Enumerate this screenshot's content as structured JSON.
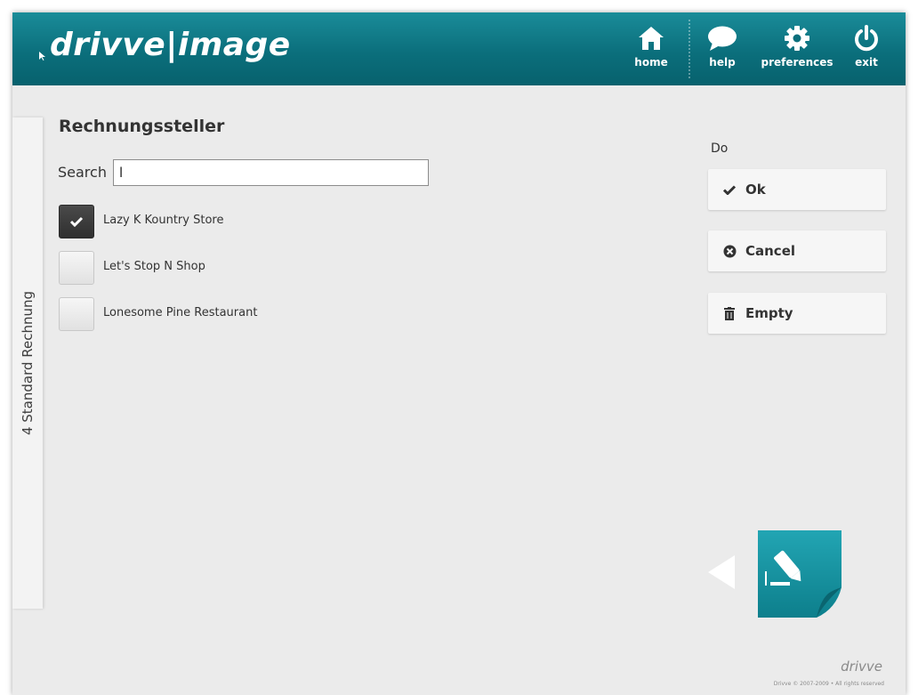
{
  "header": {
    "logo_text": "drivve|image",
    "nav": [
      {
        "label": "home",
        "icon": "home-icon"
      },
      {
        "label": "help",
        "icon": "speech-bubble-icon"
      },
      {
        "label": "preferences",
        "icon": "gear-icon"
      },
      {
        "label": "exit",
        "icon": "power-icon"
      }
    ]
  },
  "side_tab": {
    "label": "4 Standard Rechnung"
  },
  "main": {
    "title": "Rechnungssteller",
    "search": {
      "label": "Search",
      "value": "l"
    },
    "items": [
      {
        "label": "Lazy K Kountry Store",
        "checked": true
      },
      {
        "label": "Let's Stop N Shop",
        "checked": false
      },
      {
        "label": "Lonesome Pine Restaurant",
        "checked": false
      }
    ]
  },
  "actions": {
    "heading": "Do",
    "ok_label": "Ok",
    "cancel_label": "Cancel",
    "empty_label": "Empty"
  },
  "footer": {
    "logo_text": "drivve",
    "copyright": "Drivve © 2007-2009 • All rights reserved"
  },
  "colors": {
    "header_teal": "#0b7482",
    "checked_dark": "#3a3a3a",
    "doc_teal": "#1a9aa8"
  }
}
